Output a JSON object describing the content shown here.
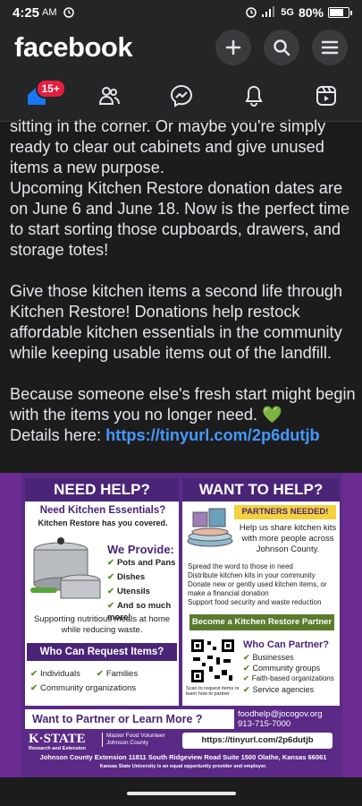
{
  "status": {
    "time": "4:25",
    "ampm": "AM",
    "network": "5G",
    "battery": "80%",
    "battery_level": 0.8
  },
  "header": {
    "logo": "facebook"
  },
  "tabs": {
    "home_badge": "15+"
  },
  "post": {
    "line1": "sitting in the corner. Or maybe you're simply ready to clear out cabinets and give unused items a new purpose.",
    "line2": "Upcoming Kitchen Restore donation dates are on June 6 and June 18. Now is the perfect time to start sorting those cupboards, drawers, and storage totes!",
    "line3": "Give those kitchen items a second life through Kitchen Restore! Donations help restock affordable kitchen essentials in the community while keeping usable items out of the landfill.",
    "line4": "Because someone else's fresh start might begin with the items you no longer need.",
    "heart": "💚",
    "details_label": "Details here:",
    "details_link": "https://tinyurl.com/2p6dutjb"
  },
  "flyer": {
    "need_help_title": "NEED HELP?",
    "need_essentials": "Need Kitchen Essentials?",
    "covered": "Kitchen Restore has you covered.",
    "we_provide": "We Provide:",
    "provide_items": [
      "Pots and Pans",
      "Dishes",
      "Utensils",
      "And so much more!"
    ],
    "supporting": "Supporting nutritious meals at home while reducing waste.",
    "who_request_title": "Who Can Request Items?",
    "request_items": [
      "Individuals",
      "Families",
      "Community organizations"
    ],
    "want_help_title": "WANT TO HELP?",
    "partners_needed": "PARTNERS NEEDED!",
    "help_us": "Help us share kitchen kits with more people across Johnson County.",
    "spread1": "Spread the word to those in need",
    "spread2": "Distribute kitchen kits in your community",
    "spread3": "Donate new or gently used kitchen items, or make a financial donation",
    "spread4": "Support food security and waste reduction",
    "become_partner": "Become a Kitchen Restore Partner",
    "who_partner_title": "Who Can Partner?",
    "partner_items": [
      "Businesses",
      "Community groups",
      "Faith-based organizations",
      "Service agencies"
    ],
    "scan_text": "Scan to request items or learn how to partner",
    "want_partner": "Want to Partner or Learn More ?",
    "email": "foodhelp@jocogov.org",
    "phone": "913-715-7000",
    "kstate": "K·STATE",
    "kstate_sub": "Research and Extension",
    "master_food": "Master Food Volunteer",
    "county": "Johnson County",
    "url": "https://tinyurl.com/2p6dutjb",
    "address": "Johnson County Extension 11811 South Ridgeview Road Suite 1500 Olathe, Kansas 66061",
    "equal": "Kansas State University is an equal opportunity provider and employer."
  },
  "colors": {
    "fb_bg": "#242526",
    "purple": "#4a2577",
    "link": "#4599ff",
    "green": "#5a8f2d",
    "badge": "#e41e3f"
  }
}
